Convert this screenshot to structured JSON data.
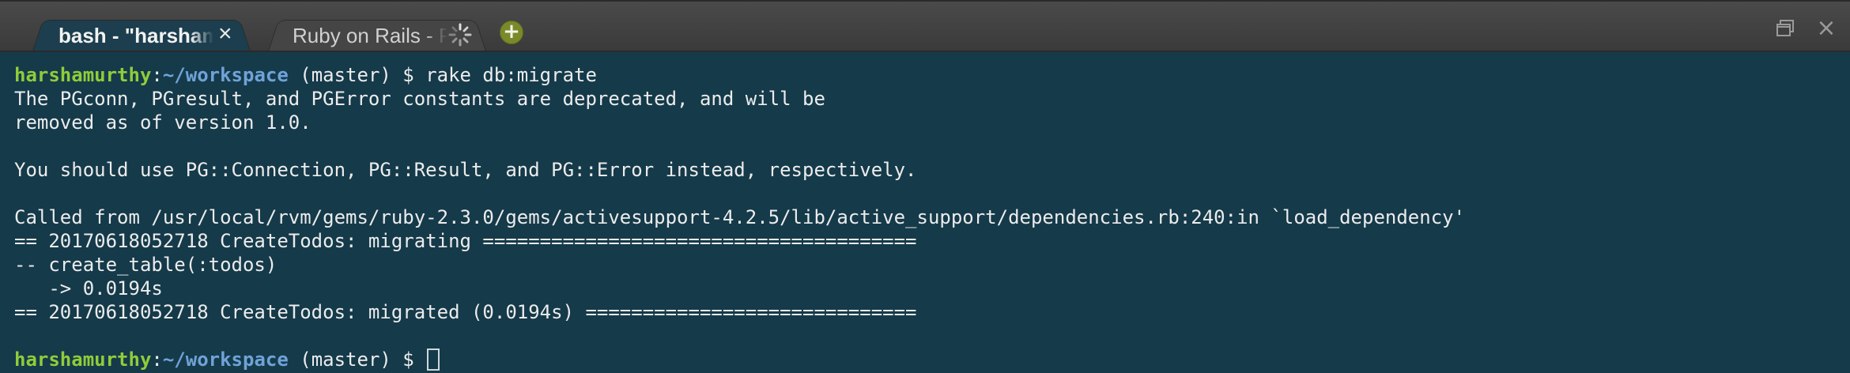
{
  "tabs": [
    {
      "label": "bash - \"harshamurthy\"",
      "active": true,
      "close_glyph": "×"
    },
    {
      "label": "Ruby on Rails - Preview",
      "active": false,
      "status_icon": "loading-spinner-icon"
    }
  ],
  "new_tab_glyph": "+",
  "window": {
    "close_glyph": "×"
  },
  "terminal": {
    "prompt": {
      "user": "harshamurthy",
      "colon": ":",
      "path": "~/workspace",
      "branch": " (master) $ "
    },
    "lines": [
      "The PGconn, PGresult, and PGError constants are deprecated, and will be",
      "removed as of version 1.0.",
      "",
      "You should use PG::Connection, PG::Result, and PG::Error instead, respectively.",
      "",
      "Called from /usr/local/rvm/gems/ruby-2.3.0/gems/activesupport-4.2.5/lib/active_support/dependencies.rb:240:in `load_dependency'",
      "== 20170618052718 CreateTodos: migrating ======================================",
      "-- create_table(:todos)",
      "   -> 0.0194s",
      "== 20170618052718 CreateTodos: migrated (0.0194s) ============================="
    ],
    "first_command": "rake db:migrate",
    "final_command": ""
  },
  "colors": {
    "terminal_bg": "#153a4a",
    "user": "#8fcd3a",
    "path": "#6fa3d8",
    "new_tab": "#7a8a2a"
  }
}
